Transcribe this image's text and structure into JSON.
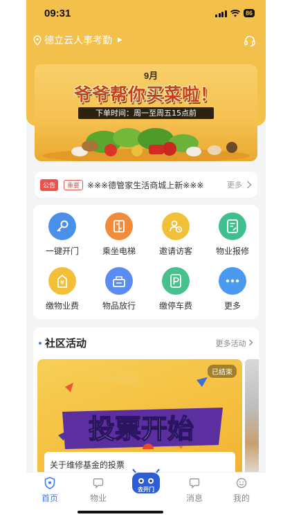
{
  "status": {
    "time": "09:31",
    "battery": "86"
  },
  "location": {
    "name": "德立云人事考勤"
  },
  "banner": {
    "month": "9月",
    "title": "爷爷帮你买菜啦！",
    "subtitle": "下单时间：周一至周五15点前"
  },
  "notice": {
    "tag": "公告",
    "importance": "重要",
    "text": "※※※德管家生活商城上新※※※",
    "more": "更多"
  },
  "services": [
    {
      "label": "一键开门",
      "icon": "key-icon",
      "color": "#4a90e8"
    },
    {
      "label": "乘坐电梯",
      "icon": "elevator-icon",
      "color": "#f08c3a"
    },
    {
      "label": "邀请访客",
      "icon": "visitor-icon",
      "color": "#f2c038"
    },
    {
      "label": "物业报修",
      "icon": "repair-icon",
      "color": "#3fbf8e"
    },
    {
      "label": "缴物业费",
      "icon": "property-fee-icon",
      "color": "#f2c038"
    },
    {
      "label": "物品放行",
      "icon": "item-release-icon",
      "color": "#5b8cf0"
    },
    {
      "label": "缴停车费",
      "icon": "parking-icon",
      "color": "#46c08c"
    },
    {
      "label": "更多",
      "icon": "more-icon",
      "color": "#4a9bf0"
    }
  ],
  "community": {
    "title": "社区活动",
    "more": "更多活动",
    "activity": {
      "status": "已结束",
      "banner_text": "投票开始",
      "caption": "关于维修基金的投票"
    }
  },
  "tabbar": {
    "tabs": [
      {
        "label": "首页"
      },
      {
        "label": "物业"
      },
      {
        "label": "去开门"
      },
      {
        "label": "消息"
      },
      {
        "label": "我的"
      }
    ]
  },
  "colors": {
    "brand": "#f3c04b",
    "active_tab": "#3b7cf4",
    "notice_red": "#f0504a"
  }
}
